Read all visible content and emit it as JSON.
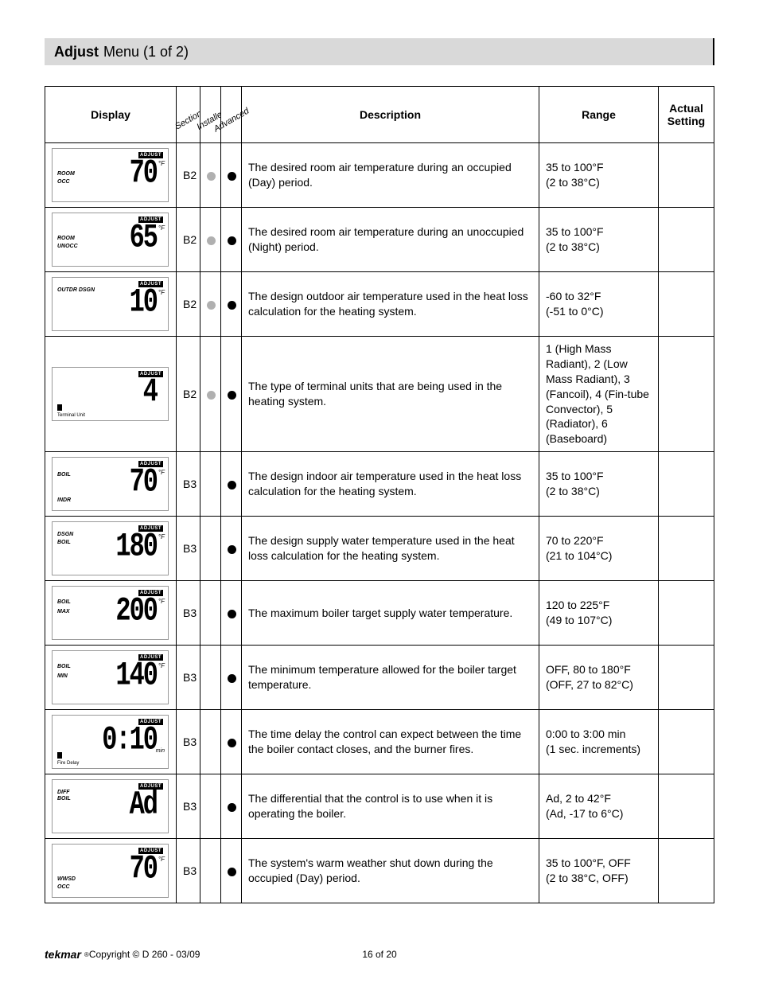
{
  "page_title_bold": "Adjust",
  "page_title_rest": " Menu (1 of 2)",
  "headers": {
    "display": "Display",
    "section": "Section",
    "installer": "Installer",
    "advanced": "Advanced",
    "description": "Description",
    "range": "Range",
    "actual": "Actual Setting"
  },
  "rows": [
    {
      "display": {
        "big": "70",
        "unit": "°F",
        "l1": "ROOM",
        "l2": "OCC",
        "adjust": "ADJUST"
      },
      "section": "B2",
      "inst": "grey",
      "adv": "black",
      "description": "The desired room air temperature during an occupied (Day) period.",
      "range": "35 to 100°F\n(2 to 38°C)"
    },
    {
      "display": {
        "big": "65",
        "unit": "°F",
        "l1": "ROOM",
        "l2": "UNOCC",
        "adjust": "ADJUST"
      },
      "section": "B2",
      "inst": "grey",
      "adv": "black",
      "description": "The desired room air temperature during an unoccupied (Night) period.",
      "range": "35 to 100°F\n(2 to 38°C)"
    },
    {
      "display": {
        "big": "10",
        "unit": "°F",
        "l3": "OUTDR  DSGN",
        "adjust": "ADJUST"
      },
      "section": "B2",
      "inst": "grey",
      "adv": "black",
      "description": "The design outdoor air temperature used in the heat loss calculation for the heating system.",
      "range": "-60 to 32°F\n(-51 to 0°C)"
    },
    {
      "display": {
        "big": "4",
        "bottom": "Terminal Unit",
        "icon": true,
        "adjust": "ADJUST"
      },
      "section": "B2",
      "inst": "grey",
      "adv": "black",
      "description": "The type of terminal units that are being used in the heating system.",
      "range": "1 (High Mass Radiant), 2 (Low Mass Radiant), 3 (Fancoil), 4 (Fin-tube Convector), 5 (Radiator), 6 (Baseboard)"
    },
    {
      "display": {
        "big": "70",
        "unit": "°F",
        "l1": "BOIL",
        "l2": "INDR",
        "adjust": "ADJUST",
        "l1top": "18",
        "l2top": "50"
      },
      "section": "B3",
      "inst": "",
      "adv": "black",
      "description": "The design indoor air temperature used in the heat loss calculation for the heating system.",
      "range": "35 to 100°F\n(2 to 38°C)"
    },
    {
      "display": {
        "big": "180",
        "unit": "°F",
        "l3": "DSGN",
        "l1": "BOIL",
        "l1top": "22",
        "adjust": "ADJUST"
      },
      "section": "B3",
      "inst": "",
      "adv": "black",
      "description": "The design supply water temperature used in the heat loss calculation for the heating system.",
      "range": "70 to 220°F\n(21 to 104°C)"
    },
    {
      "display": {
        "big": "200",
        "unit": "°F",
        "l1": "BOIL",
        "l2": "MAX",
        "l1top": "16",
        "l2top": "28",
        "adjust": "ADJUST"
      },
      "section": "B3",
      "inst": "",
      "adv": "black",
      "description": "The maximum boiler target supply water temperature.",
      "range": "120 to 225°F\n(49 to 107°C)"
    },
    {
      "display": {
        "big": "140",
        "unit": "°F",
        "l1": "BOIL",
        "l2": "MIN",
        "l1top": "16",
        "l2top": "28",
        "adjust": "ADJUST"
      },
      "section": "B3",
      "inst": "",
      "adv": "black",
      "description": "The minimum temperature allowed for the boiler target temperature.",
      "range": "OFF, 80 to 180°F\n(OFF, 27 to 82°C)"
    },
    {
      "display": {
        "big": "0:10",
        "subunit": "min",
        "bottom": "Fire Delay",
        "icon": true,
        "adjust": "ADJUST"
      },
      "section": "B3",
      "inst": "",
      "adv": "black",
      "description": "The time delay the control can expect between the time the boiler contact closes, and the burner fires.",
      "range": "0:00 to 3:00 min\n(1 sec. increments)"
    },
    {
      "display": {
        "big": "Ad",
        "l3": "DIFF",
        "l1": "BOIL",
        "l1top": "20",
        "adjust": "ADJUST"
      },
      "section": "B3",
      "inst": "",
      "adv": "black",
      "description": "The differential that the control is to use when it is operating the boiler.",
      "range": "Ad, 2 to 42°F\n(Ad, -17 to 6°C)"
    },
    {
      "display": {
        "big": "70",
        "unit": "°F",
        "l1": "WWSD",
        "l2": "OCC",
        "l1top": "40",
        "l2top": "50",
        "adjust": "ADJUST"
      },
      "section": "B3",
      "inst": "",
      "adv": "black",
      "description": "The system's warm weather shut down during the occupied (Day) period.",
      "range": "35 to 100°F, OFF\n(2 to 38°C, OFF)"
    }
  ],
  "footer": {
    "brand": "tekmar",
    "copyright": " Copyright © D 260 - 03/09",
    "page": "16 of 20"
  }
}
